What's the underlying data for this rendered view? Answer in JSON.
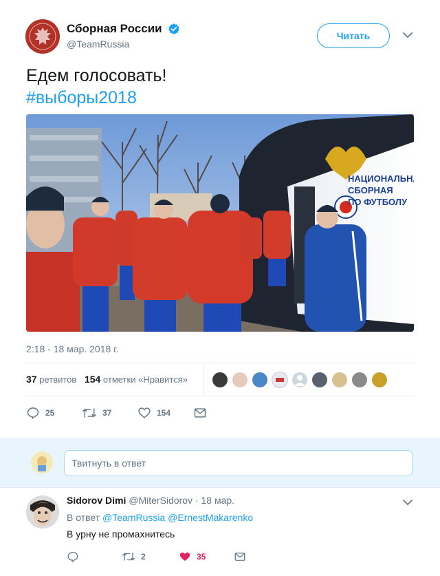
{
  "tweet": {
    "author_name": "Сборная России",
    "author_handle": "@TeamRussia",
    "follow_label": "Читать",
    "text_line1": "Едем голосовать!",
    "hashtag": "#выборы2018",
    "timestamp": "2:18 - 18 мар. 2018 г.",
    "retweets_count": "37",
    "retweets_label": "ретвитов",
    "likes_count": "154",
    "likes_label": "отметки «Нравится»",
    "actions": {
      "replies": "25",
      "retweets": "37",
      "likes": "154"
    }
  },
  "reply_box": {
    "placeholder": "Твитнуть в ответ"
  },
  "reply": {
    "author_name": "Sidorov Dimi",
    "author_handle": "@MiterSidorov",
    "date": "· 18 мар.",
    "replying_prefix": "В ответ",
    "mention1": "@TeamRussia",
    "mention2": "@ErnestMakarenko",
    "text": "В урну не промахнитесь",
    "actions": {
      "replies": "",
      "retweets": "2",
      "likes": "35"
    }
  },
  "colors": {
    "accent": "#1da1f2",
    "muted": "#657786",
    "like": "#e0245e",
    "reply_area_bg": "#e8f5fd"
  }
}
